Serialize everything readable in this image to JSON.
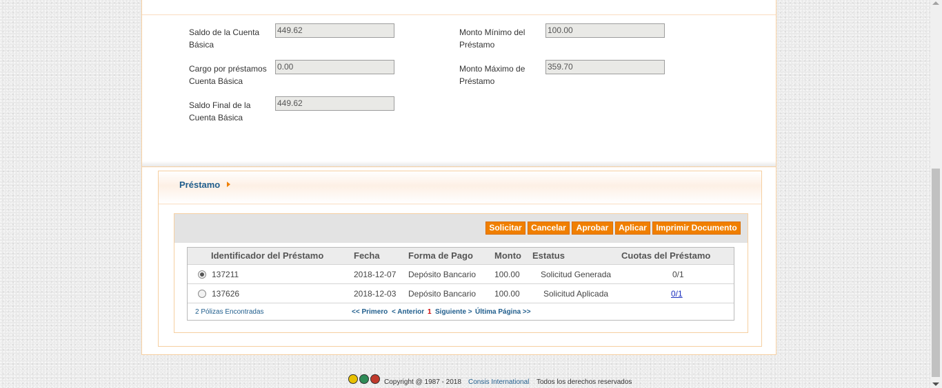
{
  "balance_form": {
    "saldo_cuenta_basica_label_1": "Saldo de la Cuenta",
    "saldo_cuenta_basica_label_2": "Básica",
    "saldo_cuenta_basica_value": "449.62",
    "cargo_prestamos_label_1": "Cargo por préstamos",
    "cargo_prestamos_label_2": "Cuenta Básica",
    "cargo_prestamos_value": "0.00",
    "saldo_final_label_1": "Saldo Final de la",
    "saldo_final_label_2": "Cuenta Básica",
    "saldo_final_value": "449.62",
    "monto_minimo_label_1": "Monto Mínimo del",
    "monto_minimo_label_2": "Préstamo",
    "monto_minimo_value": "100.00",
    "monto_maximo_label_1": "Monto Máximo de",
    "monto_maximo_label_2": "Préstamo",
    "monto_maximo_value": "359.70"
  },
  "loan_section": {
    "title": "Préstamo",
    "buttons": {
      "solicitar": "Solicitar",
      "cancelar": "Cancelar",
      "aprobar": "Aprobar",
      "aplicar": "Aplicar",
      "imprimir": "Imprimir Documento"
    },
    "table": {
      "headers": [
        "Identificador del Préstamo",
        "Fecha",
        "Forma de Pago",
        "Monto",
        "Estatus",
        "Cuotas del Préstamo"
      ],
      "rows": [
        {
          "selected": true,
          "id": "137211",
          "fecha": "2018-12-07",
          "forma_pago": "Depósito Bancario",
          "monto": "100.00",
          "estatus": "Solicitud Generada",
          "cuotas": "0/1"
        },
        {
          "selected": false,
          "id": "137626",
          "fecha": "2018-12-03",
          "forma_pago": "Depósito Bancario",
          "monto": "100.00",
          "estatus": "Solicitud Aplicada",
          "cuotas": "0/1"
        }
      ],
      "found_text": "2 Pólizas Encontradas",
      "pager": {
        "first": "<< Primero",
        "prev": "< Anterior",
        "current": "1",
        "next": "Siguiente >",
        "last": "Última Página >>"
      }
    }
  },
  "footer": {
    "copyright": "Copyright @ 1987 - 2018",
    "company": "Consis International",
    "rights": "Todos los derechos reservados"
  },
  "colors": {
    "accent_orange": "#f07f00",
    "title_blue": "#1f5d8c",
    "border_peach": "#f6cfa0"
  }
}
